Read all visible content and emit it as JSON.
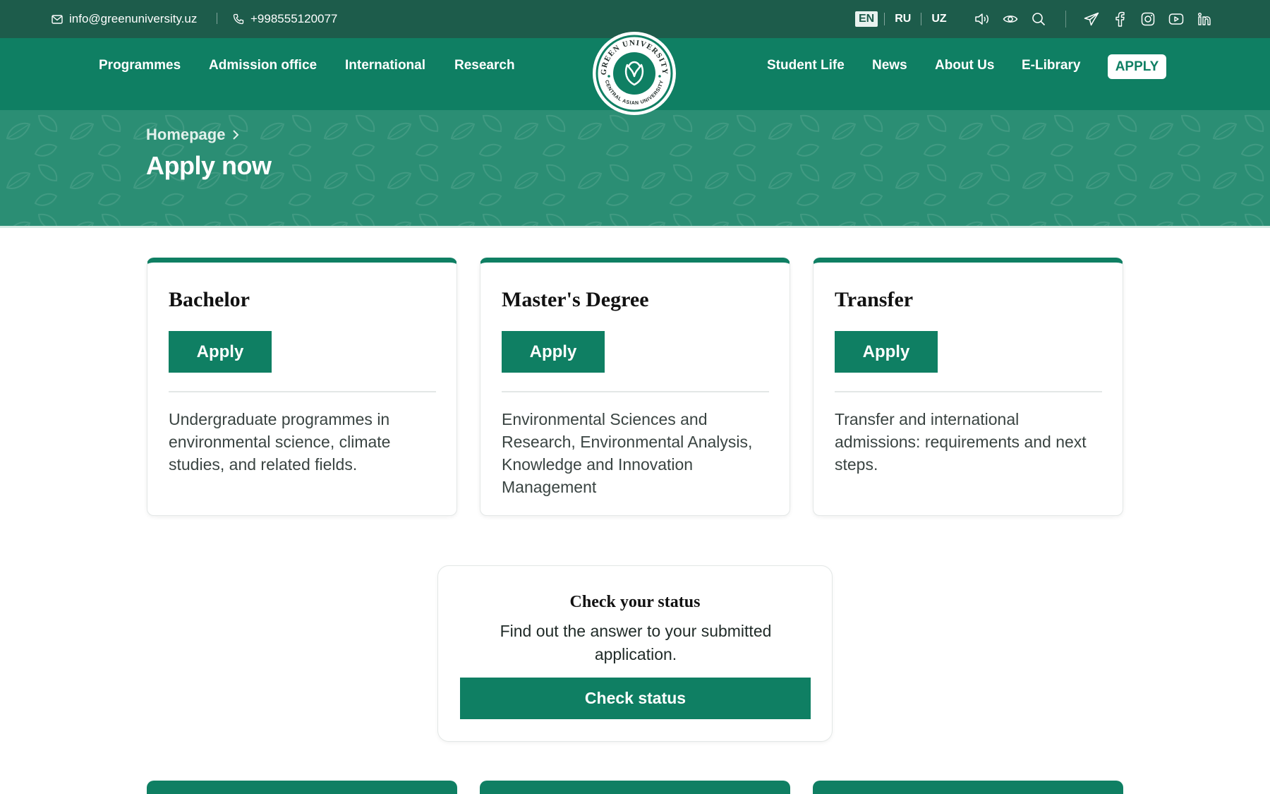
{
  "topbar": {
    "email": "info@greenuniversity.uz",
    "phone": "+998555120077",
    "languages": [
      "EN",
      "RU",
      "UZ"
    ],
    "active_language": "EN",
    "tool_icons": [
      "speaker-icon",
      "eye-icon",
      "search-icon"
    ],
    "social_icons": [
      "telegram-icon",
      "facebook-icon",
      "instagram-icon",
      "youtube-icon",
      "linkedin-icon"
    ]
  },
  "nav": {
    "left": [
      "Programmes",
      "Admission office",
      "International",
      "Research"
    ],
    "right": [
      "Student Life",
      "News",
      "About Us",
      "E-Library"
    ],
    "apply": "APPLY",
    "logo_text_top": "GREEN UNIVERSITY",
    "logo_text_bottom": "CENTRAL ASIAN UNIVERSITY"
  },
  "hero": {
    "breadcrumb": "Homepage",
    "title": "Apply now"
  },
  "cards": [
    {
      "title": "Bachelor",
      "button": "Apply",
      "description": "Undergraduate programmes in environmental science, climate studies, and related fields."
    },
    {
      "title": "Master's Degree",
      "button": "Apply",
      "description": "Environmental Sciences and Research, Environmental Analysis, Knowledge and Innovation Management"
    },
    {
      "title": "Transfer",
      "button": "Apply",
      "description": "Transfer and international admissions: requirements and next steps."
    }
  ],
  "status": {
    "title": "Check your status",
    "text": "Find out the answer to your submitted application.",
    "button": "Check status"
  },
  "colors": {
    "topbar": "#1d5c4b",
    "nav": "#0f7f63",
    "hero": "#2b8e74",
    "accent": "#0f7f63"
  }
}
